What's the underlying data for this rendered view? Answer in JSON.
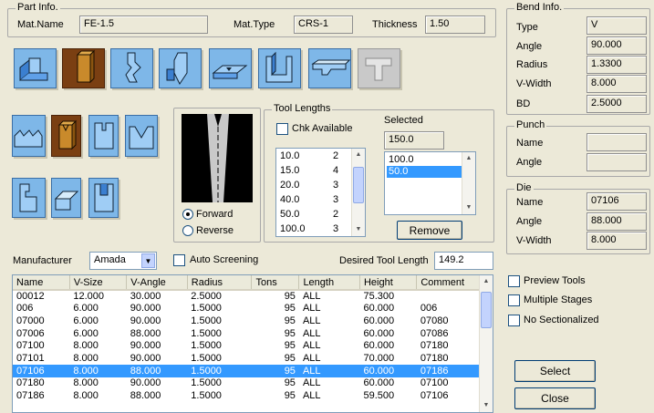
{
  "part_info": {
    "title": "Part Info.",
    "mat_name_label": "Mat.Name",
    "mat_name": "FE-1.5",
    "mat_type_label": "Mat.Type",
    "mat_type": "CRS-1",
    "thickness_label": "Thickness",
    "thickness": "1.50"
  },
  "bend_info": {
    "title": "Bend Info.",
    "type_label": "Type",
    "type": "V",
    "angle_label": "Angle",
    "angle": "90.000",
    "radius_label": "Radius",
    "radius": "1.3300",
    "vwidth_label": "V-Width",
    "vwidth": "8.000",
    "bd_label": "BD",
    "bd": "2.5000"
  },
  "punch": {
    "title": "Punch",
    "name_label": "Name",
    "name": "",
    "angle_label": "Angle",
    "angle": ""
  },
  "die": {
    "title": "Die",
    "name_label": "Name",
    "name": "07106",
    "angle_label": "Angle",
    "angle": "88.000",
    "vwidth_label": "V-Width",
    "vwidth": "8.000"
  },
  "tool_lengths": {
    "title": "Tool Lengths",
    "chk_available_label": "Chk Available",
    "selected_label": "Selected",
    "selected_total": "150.0",
    "available": [
      {
        "length": "10.0",
        "count": "2"
      },
      {
        "length": "15.0",
        "count": "4"
      },
      {
        "length": "20.0",
        "count": "3"
      },
      {
        "length": "40.0",
        "count": "3"
      },
      {
        "length": "50.0",
        "count": "2"
      },
      {
        "length": "100.0",
        "count": "3"
      }
    ],
    "selected_items": [
      "100.0",
      "50.0"
    ],
    "remove_label": "Remove"
  },
  "orientation": {
    "forward_label": "Forward",
    "reverse_label": "Reverse",
    "value": "Forward"
  },
  "manufacturer_label": "Manufacturer",
  "manufacturer": "Amada",
  "auto_screening_label": "Auto Screening",
  "desired_tool_length_label": "Desired Tool Length",
  "desired_tool_length": "149.2",
  "table": {
    "columns": [
      "Name",
      "V-Size",
      "V-Angle",
      "Radius",
      "Tons",
      "Length",
      "Height",
      "Comment"
    ],
    "rows": [
      [
        "00012",
        "12.000",
        "30.000",
        "2.5000",
        "95",
        "ALL",
        "75.300",
        ""
      ],
      [
        "006",
        "6.000",
        "90.000",
        "1.5000",
        "95",
        "ALL",
        "60.000",
        "006"
      ],
      [
        "07000",
        "6.000",
        "90.000",
        "1.5000",
        "95",
        "ALL",
        "60.000",
        "07080"
      ],
      [
        "07006",
        "6.000",
        "88.000",
        "1.5000",
        "95",
        "ALL",
        "60.000",
        "07086"
      ],
      [
        "07100",
        "8.000",
        "90.000",
        "1.5000",
        "95",
        "ALL",
        "60.000",
        "07180"
      ],
      [
        "07101",
        "8.000",
        "90.000",
        "1.5000",
        "95",
        "ALL",
        "70.000",
        "07180"
      ],
      [
        "07106",
        "8.000",
        "88.000",
        "1.5000",
        "95",
        "ALL",
        "60.000",
        "07186"
      ],
      [
        "07180",
        "8.000",
        "90.000",
        "1.5000",
        "95",
        "ALL",
        "60.000",
        "07100"
      ],
      [
        "07186",
        "8.000",
        "88.000",
        "1.5000",
        "95",
        "ALL",
        "59.500",
        "07106"
      ]
    ],
    "selected_row": 6
  },
  "options": {
    "preview_tools_label": "Preview Tools",
    "multiple_stages_label": "Multiple Stages",
    "no_sectionalized_label": "No Sectionalized"
  },
  "buttons": {
    "select_label": "Select",
    "close_label": "Close"
  },
  "colors": {
    "tool_blue": "#7eb7e8",
    "tool_selected": "#7a3f12",
    "row_highlight": "#3399ff",
    "dialog_bg": "#ece9d8"
  }
}
